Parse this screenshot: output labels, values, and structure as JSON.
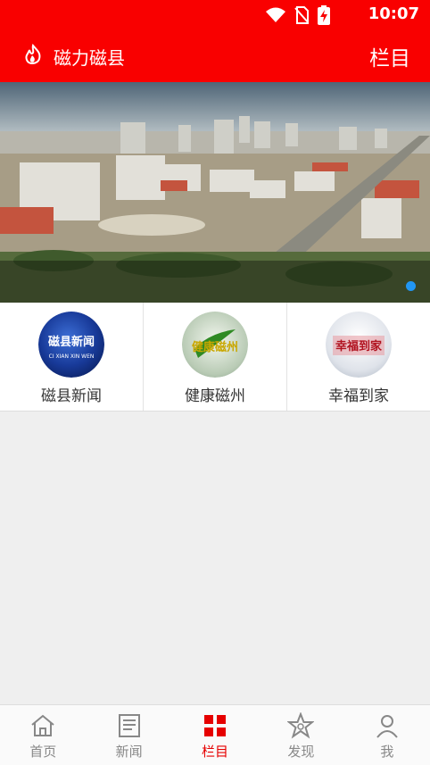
{
  "status_bar": {
    "time": "10:07"
  },
  "app_bar": {
    "title": "磁力磁县",
    "right_label": "栏目"
  },
  "channels": [
    {
      "label": "磁县新闻",
      "thumb_text": "磁县新闻",
      "thumb_sub": "CI XIAN XIN WEN"
    },
    {
      "label": "健康磁州",
      "thumb_text": "健康磁州",
      "thumb_sub": ""
    },
    {
      "label": "幸福到家",
      "thumb_text": "幸福到家",
      "thumb_sub": ""
    }
  ],
  "tabs": [
    {
      "label": "首页",
      "icon": "home-icon"
    },
    {
      "label": "新闻",
      "icon": "news-icon"
    },
    {
      "label": "栏目",
      "icon": "grid-icon"
    },
    {
      "label": "发现",
      "icon": "discover-icon"
    },
    {
      "label": "我",
      "icon": "profile-icon"
    }
  ],
  "colors": {
    "brand": "#f90000",
    "active_tab": "#e60000",
    "indicator": "#2196f3"
  }
}
